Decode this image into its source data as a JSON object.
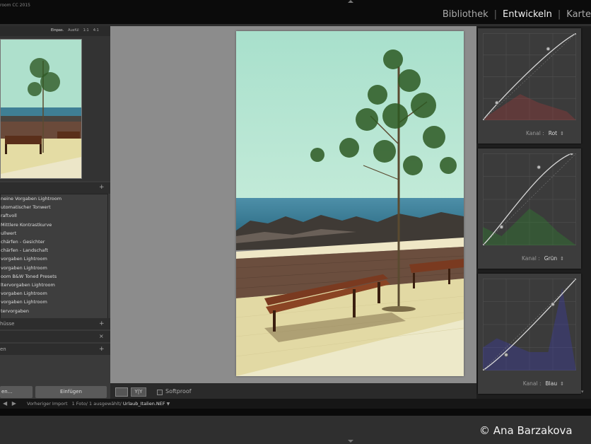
{
  "app": {
    "title": "room CC 2015"
  },
  "modules": [
    "Bibliothek",
    "Entwickeln",
    "Karte"
  ],
  "active_module": "Entwickeln",
  "navigator": {
    "options": [
      "Einpas.",
      "Ausfül",
      "1:1",
      "4:1"
    ]
  },
  "presets": {
    "items": [
      "neine Vorgaben Lightroom",
      "utomatischer Tonwert",
      "raftvoll",
      "Mittlere Kontrastkurve",
      "ullwert",
      "chärfen - Gesichter",
      "chärfen - Landschaft",
      "vorgaben Lightroom",
      "vorgaben Lightroom",
      "oom B&W Toned Presets",
      "ltervorgaben Lightroom",
      "vorgaben Lightroom",
      "vorgaben Lightroom",
      "tervorgaben"
    ]
  },
  "panels": {
    "snapshots": "hüsse",
    "collections": "en"
  },
  "buttons": {
    "copy": "en...",
    "paste": "Einfügen"
  },
  "toolbar": {
    "softproof": "Softproof",
    "compare": "Y|Y"
  },
  "curves": [
    {
      "channel_label": "Kanal :",
      "channel": "Rot",
      "color": "#a43838"
    },
    {
      "channel_label": "Kanal :",
      "channel": "Grün",
      "color": "#2f8a2f"
    },
    {
      "channel_label": "Kanal :",
      "channel": "Blau",
      "color": "#3b3bb0"
    }
  ],
  "filmstrip": {
    "source": "Vorheriger Import",
    "info": "1 Foto/ 1 ausgewählt/",
    "filename": "Urlaub_Italien.NEF"
  },
  "credit": "© Ana Barzakova",
  "icons": {
    "nav_back": "arrow-left-icon",
    "nav_forward": "arrow-right-icon"
  }
}
